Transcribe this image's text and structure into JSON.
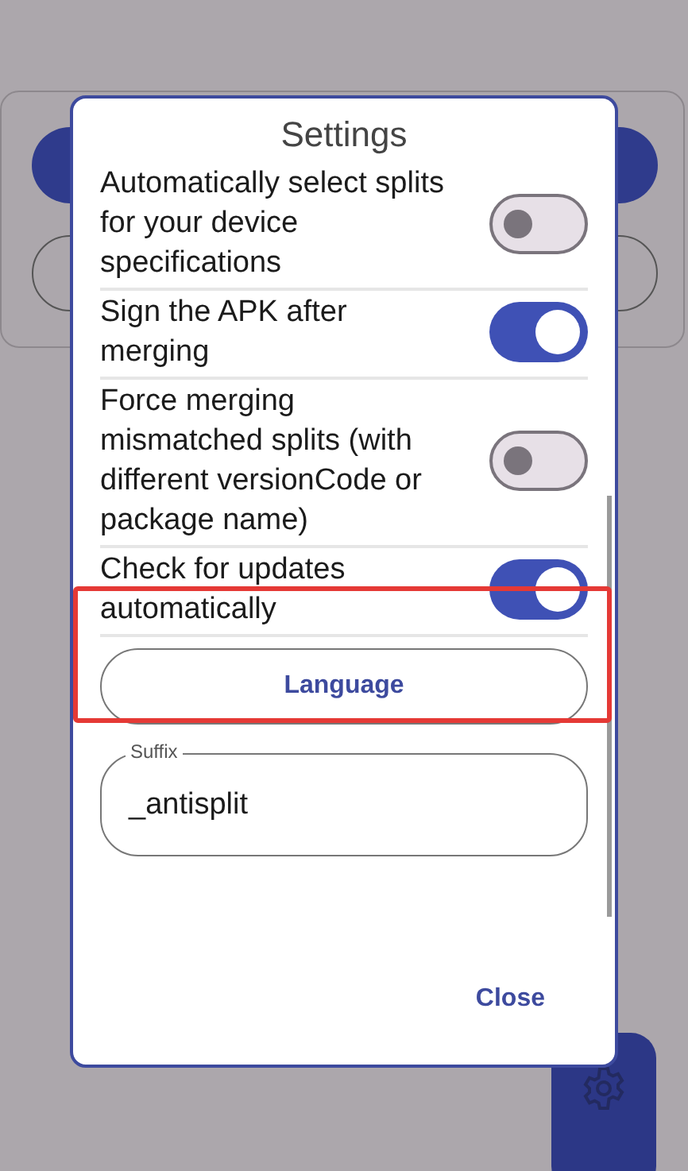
{
  "dialog": {
    "title": "Settings",
    "settings": [
      {
        "label": "Automatically select splits for your device specifications",
        "on": false
      },
      {
        "label": "Sign the APK after merging",
        "on": true
      },
      {
        "label": "Force merging mismatched splits (with different versionCode or package name)",
        "on": false
      },
      {
        "label": "Check for updates automatically",
        "on": true
      }
    ],
    "language_button": "Language",
    "suffix_field": {
      "label": "Suffix",
      "value": "_antisplit"
    },
    "close_button": "Close"
  }
}
